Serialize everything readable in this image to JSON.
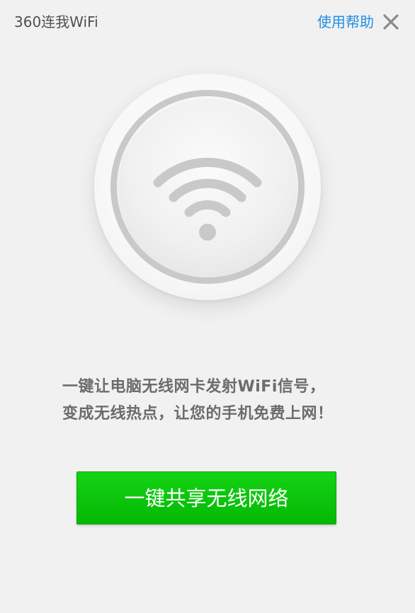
{
  "window": {
    "title": "360连我WiFi",
    "help_link": "使用帮助"
  },
  "main": {
    "description_line_1": "一键让电脑无线网卡发射WiFi信号，",
    "description_line_2": "变成无线热点，让您的手机免费上网！",
    "share_button_label": "一键共享无线网络"
  },
  "icons": {
    "close": "close-icon",
    "wifi": "wifi-icon"
  },
  "colors": {
    "background": "#f1f1f1",
    "help_link": "#1f8fe3",
    "button_green": "#0cc40c",
    "text": "#6c6c6c"
  }
}
